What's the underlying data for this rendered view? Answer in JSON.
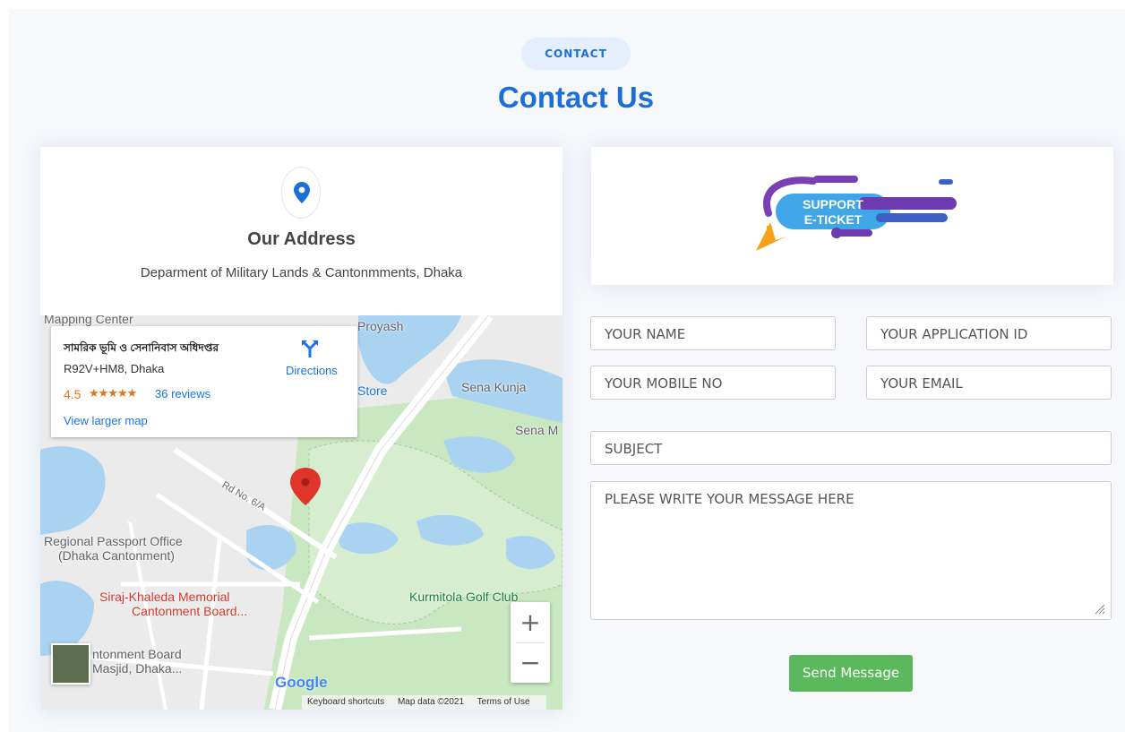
{
  "section": {
    "tag": "CONTACT",
    "title": "Contact Us"
  },
  "address": {
    "title": "Our Address",
    "text": "Deparment of Military Lands & Cantonmments, Dhaka"
  },
  "map": {
    "place_name": "সামরিক ভূমি ও সেনানিবাস অধিদপ্তর",
    "plus_code": "R92V+HM8, Dhaka",
    "rating": "4.5",
    "stars": "★★★★★",
    "reviews": "36 reviews",
    "directions": "Directions",
    "view_larger": "View larger map",
    "zoom_in": "+",
    "zoom_out": "−",
    "google": "Google",
    "keyboard": "Keyboard shortcuts",
    "map_data": "Map data ©2021",
    "terms": "Terms of Use",
    "labels": {
      "mapping_center": "Mapping Center",
      "proyash": "Proyash",
      "store": "Store",
      "sena_kunja": "Sena Kunja",
      "sena_m": "Sena M",
      "rd_no": "Rd No. 6/A",
      "passport": "Regional Passport Office",
      "passport2": "(Dhaka Cantonment)",
      "siraj": "Siraj-Khaleda Memorial",
      "siraj2": "Cantonment Board...",
      "kurmitola": "Kurmitola Golf Club",
      "masjid": "ntonment Board",
      "masjid2": "Masjid, Dhaka..."
    }
  },
  "support_banner": {
    "line1": "SUPPORT",
    "line2": "E-TICKET"
  },
  "form": {
    "name_placeholder": "YOUR NAME",
    "app_id_placeholder": "YOUR APPLICATION ID",
    "mobile_placeholder": "YOUR MOBILE NO",
    "email_placeholder": "YOUR EMAIL",
    "subject_placeholder": "SUBJECT",
    "message_placeholder": "PLEASE WRITE YOUR MESSAGE HERE",
    "send_label": "Send Message"
  },
  "colors": {
    "accent": "#1c6fd6",
    "send_button": "#5cb85c",
    "map_water": "#aad3f2",
    "map_green": "#c8e6c1",
    "map_pin": "#e0352b"
  }
}
